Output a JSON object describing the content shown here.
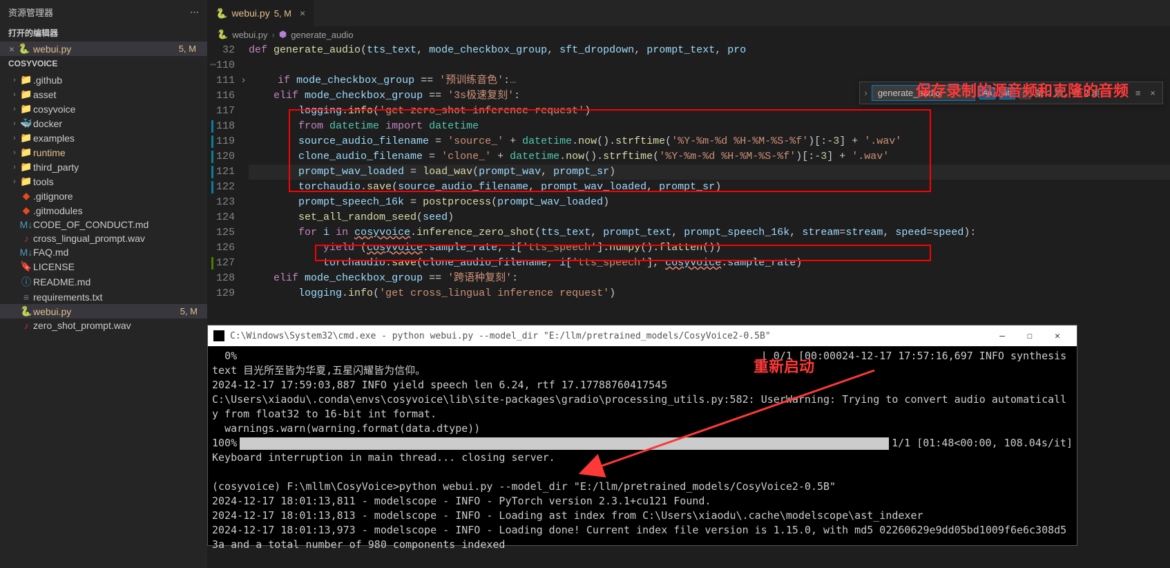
{
  "sidebar": {
    "title": "资源管理器",
    "openEditorsHeader": "打开的编辑器",
    "openEditor": {
      "name": "webui.py",
      "status": "5, M"
    },
    "projectName": "COSYVOICE",
    "items": [
      {
        "icon": "folder",
        "label": ".github",
        "chevron": "›"
      },
      {
        "icon": "folder",
        "label": "asset",
        "chevron": "›"
      },
      {
        "icon": "folder",
        "label": "cosyvoice",
        "chevron": "›"
      },
      {
        "icon": "docker",
        "label": "docker",
        "chevron": "›"
      },
      {
        "icon": "folder",
        "label": "examples",
        "chevron": "›"
      },
      {
        "icon": "folder",
        "label": "runtime",
        "chevron": "›",
        "highlight": true
      },
      {
        "icon": "folder",
        "label": "third_party",
        "chevron": "›"
      },
      {
        "icon": "folder",
        "label": "tools",
        "chevron": "›"
      },
      {
        "icon": "git",
        "label": ".gitignore"
      },
      {
        "icon": "git",
        "label": ".gitmodules"
      },
      {
        "icon": "md",
        "label": "CODE_OF_CONDUCT.md"
      },
      {
        "icon": "wav",
        "label": "cross_lingual_prompt.wav"
      },
      {
        "icon": "md",
        "label": "FAQ.md"
      },
      {
        "icon": "lic",
        "label": "LICENSE"
      },
      {
        "icon": "readme",
        "label": "README.md"
      },
      {
        "icon": "txt",
        "label": "requirements.txt"
      },
      {
        "icon": "py",
        "label": "webui.py",
        "status": "5, M",
        "selected": true
      },
      {
        "icon": "wav",
        "label": "zero_shot_prompt.wav"
      }
    ]
  },
  "tab": {
    "name": "webui.py",
    "status": "5, M"
  },
  "breadcrumb": {
    "file": "webui.py",
    "symbol": "generate_audio"
  },
  "find": {
    "query": "generate_audio",
    "count": "第 ? 项，共 2 项"
  },
  "code": {
    "lines": [
      {
        "n": 32,
        "html": "<span class='kw'>def</span> <span class='fn'>generate_audio</span>(<span class='var'>tts_text</span>, <span class='var'>mode_checkbox_group</span>, <span class='var'>sft_dropdown</span>, <span class='var'>prompt_text</span>, <span class='var'>pro</span>"
      },
      {
        "n": 110,
        "html": "",
        "dots": true
      },
      {
        "n": 111,
        "html": "    <span class='kw'>if</span> <span class='var'>mode_checkbox_group</span> <span class='op'>==</span> <span class='str'>'预训练音色'</span>:<span class='dim-text'>…</span>",
        "chev": true
      },
      {
        "n": 116,
        "html": "    <span class='kw'>elif</span> <span class='var'>mode_checkbox_group</span> <span class='op'>==</span> <span class='str'>'3s极速复刻'</span>:"
      },
      {
        "n": 117,
        "html": "        <span class='var'>logging</span>.<span class='fn'>info</span>(<span class='str'>'get zero_shot inference request'</span>)"
      },
      {
        "n": 118,
        "html": "        <span class='kw'>from</span> <span class='cls'>datetime</span> <span class='kw'>import</span> <span class='cls'>datetime</span>",
        "mod": true
      },
      {
        "n": 119,
        "html": "        <span class='var'>source_audio_filename</span> = <span class='str'>'source_'</span> + <span class='cls'>datetime</span>.<span class='fn'>now</span>().<span class='fn'>strftime</span>(<span class='str'>'%Y-%m-%d %H-%M-%S-%f'</span>)[:-<span class='num'>3</span>] + <span class='str'>'.wav'</span>",
        "mod": true
      },
      {
        "n": 120,
        "html": "        <span class='var'>clone_audio_filename</span> = <span class='str'>'clone_'</span> + <span class='cls'>datetime</span>.<span class='fn'>now</span>().<span class='fn'>strftime</span>(<span class='str'>'%Y-%m-%d %H-%M-%S-%f'</span>)[:-<span class='num'>3</span>] + <span class='str'>'.wav'</span>",
        "mod": true
      },
      {
        "n": 121,
        "html": "        <span class='var'>prompt_wav_loaded</span> = <span class='fn'>load_wav</span>(<span class='var'>prompt_wav</span>, <span class='var'>prompt_sr</span>)",
        "mod": true,
        "current": true
      },
      {
        "n": 122,
        "html": "        <span class='var'>torchaudio</span>.<span class='fn'>save</span>(<span class='var'>source_audio_filename</span>, <span class='var'>prompt_wav_loaded</span>, <span class='var'>prompt_sr</span>)",
        "mod": true
      },
      {
        "n": 123,
        "html": "        <span class='var'>prompt_speech_16k</span> = <span class='fn'>postprocess</span>(<span class='var'>prompt_wav_loaded</span>)"
      },
      {
        "n": 124,
        "html": "        <span class='fn'>set_all_random_seed</span>(<span class='var'>seed</span>)"
      },
      {
        "n": 125,
        "html": "        <span class='kw'>for</span> <span class='var'>i</span> <span class='kw'>in</span> <span class='var squiggle'>cosyvoice</span>.<span class='fn'>inference_zero_shot</span>(<span class='var'>tts_text</span>, <span class='var'>prompt_text</span>, <span class='var'>prompt_speech_16k</span>, <span class='var'>stream</span>=<span class='var'>stream</span>, <span class='var'>speed</span>=<span class='var'>speed</span>):"
      },
      {
        "n": 126,
        "html": "            <span class='kw'>yield</span> (<span class='var squiggle'>cosyvoice</span>.<span class='var'>sample_rate</span>, <span class='var'>i</span>[<span class='str'>'tts_speech'</span>].<span class='fn'>numpy</span>().<span class='fn'>flatten</span>())"
      },
      {
        "n": 127,
        "html": "            <span class='var'>torchaudio</span>.<span class='fn'>save</span>(<span class='var'>clone_audio_filename</span>, <span class='var'>i</span>[<span class='str'>'tts_speech'</span>], <span class='var squiggle'>cosyvoice</span>.<span class='var'>sample_rate</span>)",
        "add": true
      },
      {
        "n": 128,
        "html": "    <span class='kw'>elif</span> <span class='var'>mode_checkbox_group</span> <span class='op'>==</span> <span class='str'>'跨语种复刻'</span>:"
      },
      {
        "n": 129,
        "html": "        <span class='var'>logging</span>.<span class='fn'>info</span>(<span class='str'>'get cross_lingual inference request'</span>)"
      }
    ]
  },
  "annotations": {
    "top": "保存录制的源音频和克隆的音频",
    "restart": "重新启动"
  },
  "terminal": {
    "title": "C:\\Windows\\System32\\cmd.exe - python  webui.py --model_dir \"E:/llm/pretrained_models/CosyVoice2-0.5B\"",
    "lines": [
      "  0%                                                                                    | 0/1 [00:00<?, ?it/s]2",
      "024-12-17 17:57:16,697 INFO synthesis text 目光所至皆为华夏,五星闪耀皆为信仰。",
      "2024-12-17 17:59:03,887 INFO yield speech len 6.24, rtf 17.17788760417545",
      "C:\\Users\\xiaodu\\.conda\\envs\\cosyvoice\\lib\\site-packages\\gradio\\processing_utils.py:582: UserWarning: Trying to convert audio automaticall",
      "y from float32 to 16-bit int format.",
      "  warnings.warn(warning.format(data.dtype))"
    ],
    "progress": {
      "left": "100%",
      "right": "1/1 [01:48<00:00, 108.04s/it]"
    },
    "lines2": [
      "Keyboard interruption in main thread... closing server.",
      "",
      "(cosyvoice) F:\\mllm\\CosyVoice>python webui.py --model_dir \"E:/llm/pretrained_models/CosyVoice2-0.5B\"",
      "2024-12-17 18:01:13,811 - modelscope - INFO - PyTorch version 2.3.1+cu121 Found.",
      "2024-12-17 18:01:13,813 - modelscope - INFO - Loading ast index from C:\\Users\\xiaodu\\.cache\\modelscope\\ast_indexer",
      "2024-12-17 18:01:13,973 - modelscope - INFO - Loading done! Current index file version is 1.15.0, with md5 02260629e9dd05bd1009f6e6c308d5",
      "3a and a total number of 980 components indexed"
    ]
  }
}
